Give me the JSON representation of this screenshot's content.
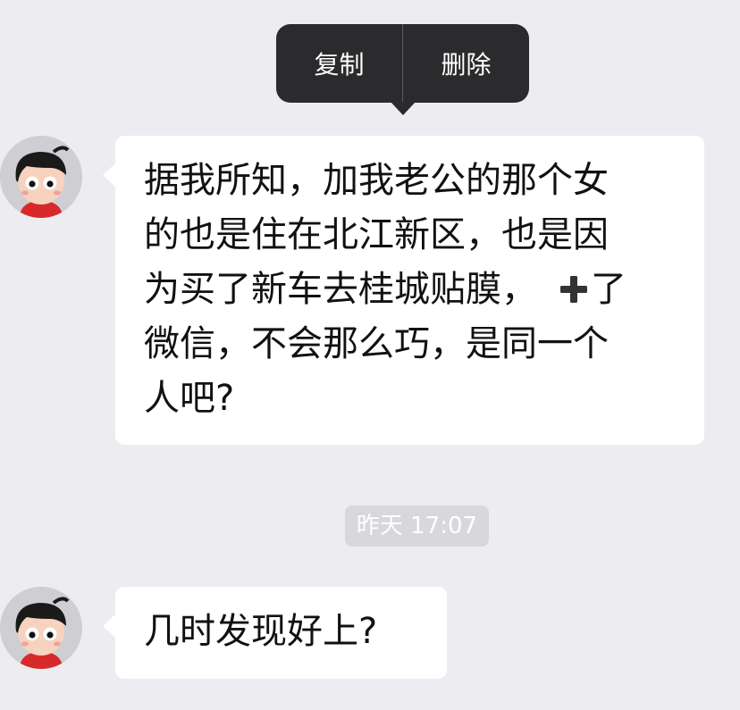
{
  "context_menu": {
    "copy_label": "复制",
    "delete_label": "删除"
  },
  "messages": [
    {
      "lines": [
        "据我所知，加我老公的那个女",
        "的也是住在北江新区，也是因",
        "为买了新车去桂城贴膜，",
        "了",
        "微信，不会那么巧，是同一个",
        "人吧?"
      ],
      "inline_icon": "plus-icon"
    },
    {
      "text": "几时发现好上?"
    }
  ],
  "timestamp": "昨天 17:07",
  "avatar_icon": "cartoon-boy-avatar-icon",
  "colors": {
    "background": "#ededf1",
    "bubble": "#ffffff",
    "menu": "#2b2b2d",
    "timestamp_bg": "#d8d8dc"
  }
}
